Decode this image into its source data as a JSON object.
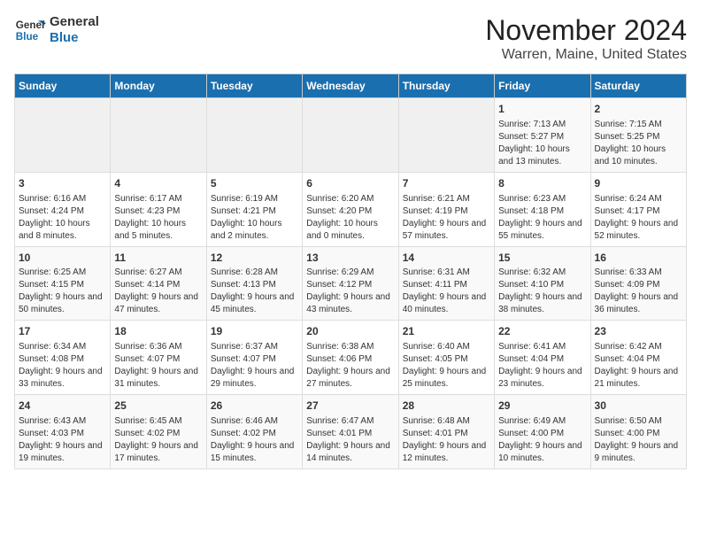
{
  "header": {
    "logo_line1": "General",
    "logo_line2": "Blue",
    "month": "November 2024",
    "location": "Warren, Maine, United States"
  },
  "days_of_week": [
    "Sunday",
    "Monday",
    "Tuesday",
    "Wednesday",
    "Thursday",
    "Friday",
    "Saturday"
  ],
  "weeks": [
    [
      {
        "day": "",
        "info": ""
      },
      {
        "day": "",
        "info": ""
      },
      {
        "day": "",
        "info": ""
      },
      {
        "day": "",
        "info": ""
      },
      {
        "day": "",
        "info": ""
      },
      {
        "day": "1",
        "info": "Sunrise: 7:13 AM\nSunset: 5:27 PM\nDaylight: 10 hours and 13 minutes."
      },
      {
        "day": "2",
        "info": "Sunrise: 7:15 AM\nSunset: 5:25 PM\nDaylight: 10 hours and 10 minutes."
      }
    ],
    [
      {
        "day": "3",
        "info": "Sunrise: 6:16 AM\nSunset: 4:24 PM\nDaylight: 10 hours and 8 minutes."
      },
      {
        "day": "4",
        "info": "Sunrise: 6:17 AM\nSunset: 4:23 PM\nDaylight: 10 hours and 5 minutes."
      },
      {
        "day": "5",
        "info": "Sunrise: 6:19 AM\nSunset: 4:21 PM\nDaylight: 10 hours and 2 minutes."
      },
      {
        "day": "6",
        "info": "Sunrise: 6:20 AM\nSunset: 4:20 PM\nDaylight: 10 hours and 0 minutes."
      },
      {
        "day": "7",
        "info": "Sunrise: 6:21 AM\nSunset: 4:19 PM\nDaylight: 9 hours and 57 minutes."
      },
      {
        "day": "8",
        "info": "Sunrise: 6:23 AM\nSunset: 4:18 PM\nDaylight: 9 hours and 55 minutes."
      },
      {
        "day": "9",
        "info": "Sunrise: 6:24 AM\nSunset: 4:17 PM\nDaylight: 9 hours and 52 minutes."
      }
    ],
    [
      {
        "day": "10",
        "info": "Sunrise: 6:25 AM\nSunset: 4:15 PM\nDaylight: 9 hours and 50 minutes."
      },
      {
        "day": "11",
        "info": "Sunrise: 6:27 AM\nSunset: 4:14 PM\nDaylight: 9 hours and 47 minutes."
      },
      {
        "day": "12",
        "info": "Sunrise: 6:28 AM\nSunset: 4:13 PM\nDaylight: 9 hours and 45 minutes."
      },
      {
        "day": "13",
        "info": "Sunrise: 6:29 AM\nSunset: 4:12 PM\nDaylight: 9 hours and 43 minutes."
      },
      {
        "day": "14",
        "info": "Sunrise: 6:31 AM\nSunset: 4:11 PM\nDaylight: 9 hours and 40 minutes."
      },
      {
        "day": "15",
        "info": "Sunrise: 6:32 AM\nSunset: 4:10 PM\nDaylight: 9 hours and 38 minutes."
      },
      {
        "day": "16",
        "info": "Sunrise: 6:33 AM\nSunset: 4:09 PM\nDaylight: 9 hours and 36 minutes."
      }
    ],
    [
      {
        "day": "17",
        "info": "Sunrise: 6:34 AM\nSunset: 4:08 PM\nDaylight: 9 hours and 33 minutes."
      },
      {
        "day": "18",
        "info": "Sunrise: 6:36 AM\nSunset: 4:07 PM\nDaylight: 9 hours and 31 minutes."
      },
      {
        "day": "19",
        "info": "Sunrise: 6:37 AM\nSunset: 4:07 PM\nDaylight: 9 hours and 29 minutes."
      },
      {
        "day": "20",
        "info": "Sunrise: 6:38 AM\nSunset: 4:06 PM\nDaylight: 9 hours and 27 minutes."
      },
      {
        "day": "21",
        "info": "Sunrise: 6:40 AM\nSunset: 4:05 PM\nDaylight: 9 hours and 25 minutes."
      },
      {
        "day": "22",
        "info": "Sunrise: 6:41 AM\nSunset: 4:04 PM\nDaylight: 9 hours and 23 minutes."
      },
      {
        "day": "23",
        "info": "Sunrise: 6:42 AM\nSunset: 4:04 PM\nDaylight: 9 hours and 21 minutes."
      }
    ],
    [
      {
        "day": "24",
        "info": "Sunrise: 6:43 AM\nSunset: 4:03 PM\nDaylight: 9 hours and 19 minutes."
      },
      {
        "day": "25",
        "info": "Sunrise: 6:45 AM\nSunset: 4:02 PM\nDaylight: 9 hours and 17 minutes."
      },
      {
        "day": "26",
        "info": "Sunrise: 6:46 AM\nSunset: 4:02 PM\nDaylight: 9 hours and 15 minutes."
      },
      {
        "day": "27",
        "info": "Sunrise: 6:47 AM\nSunset: 4:01 PM\nDaylight: 9 hours and 14 minutes."
      },
      {
        "day": "28",
        "info": "Sunrise: 6:48 AM\nSunset: 4:01 PM\nDaylight: 9 hours and 12 minutes."
      },
      {
        "day": "29",
        "info": "Sunrise: 6:49 AM\nSunset: 4:00 PM\nDaylight: 9 hours and 10 minutes."
      },
      {
        "day": "30",
        "info": "Sunrise: 6:50 AM\nSunset: 4:00 PM\nDaylight: 9 hours and 9 minutes."
      }
    ]
  ]
}
